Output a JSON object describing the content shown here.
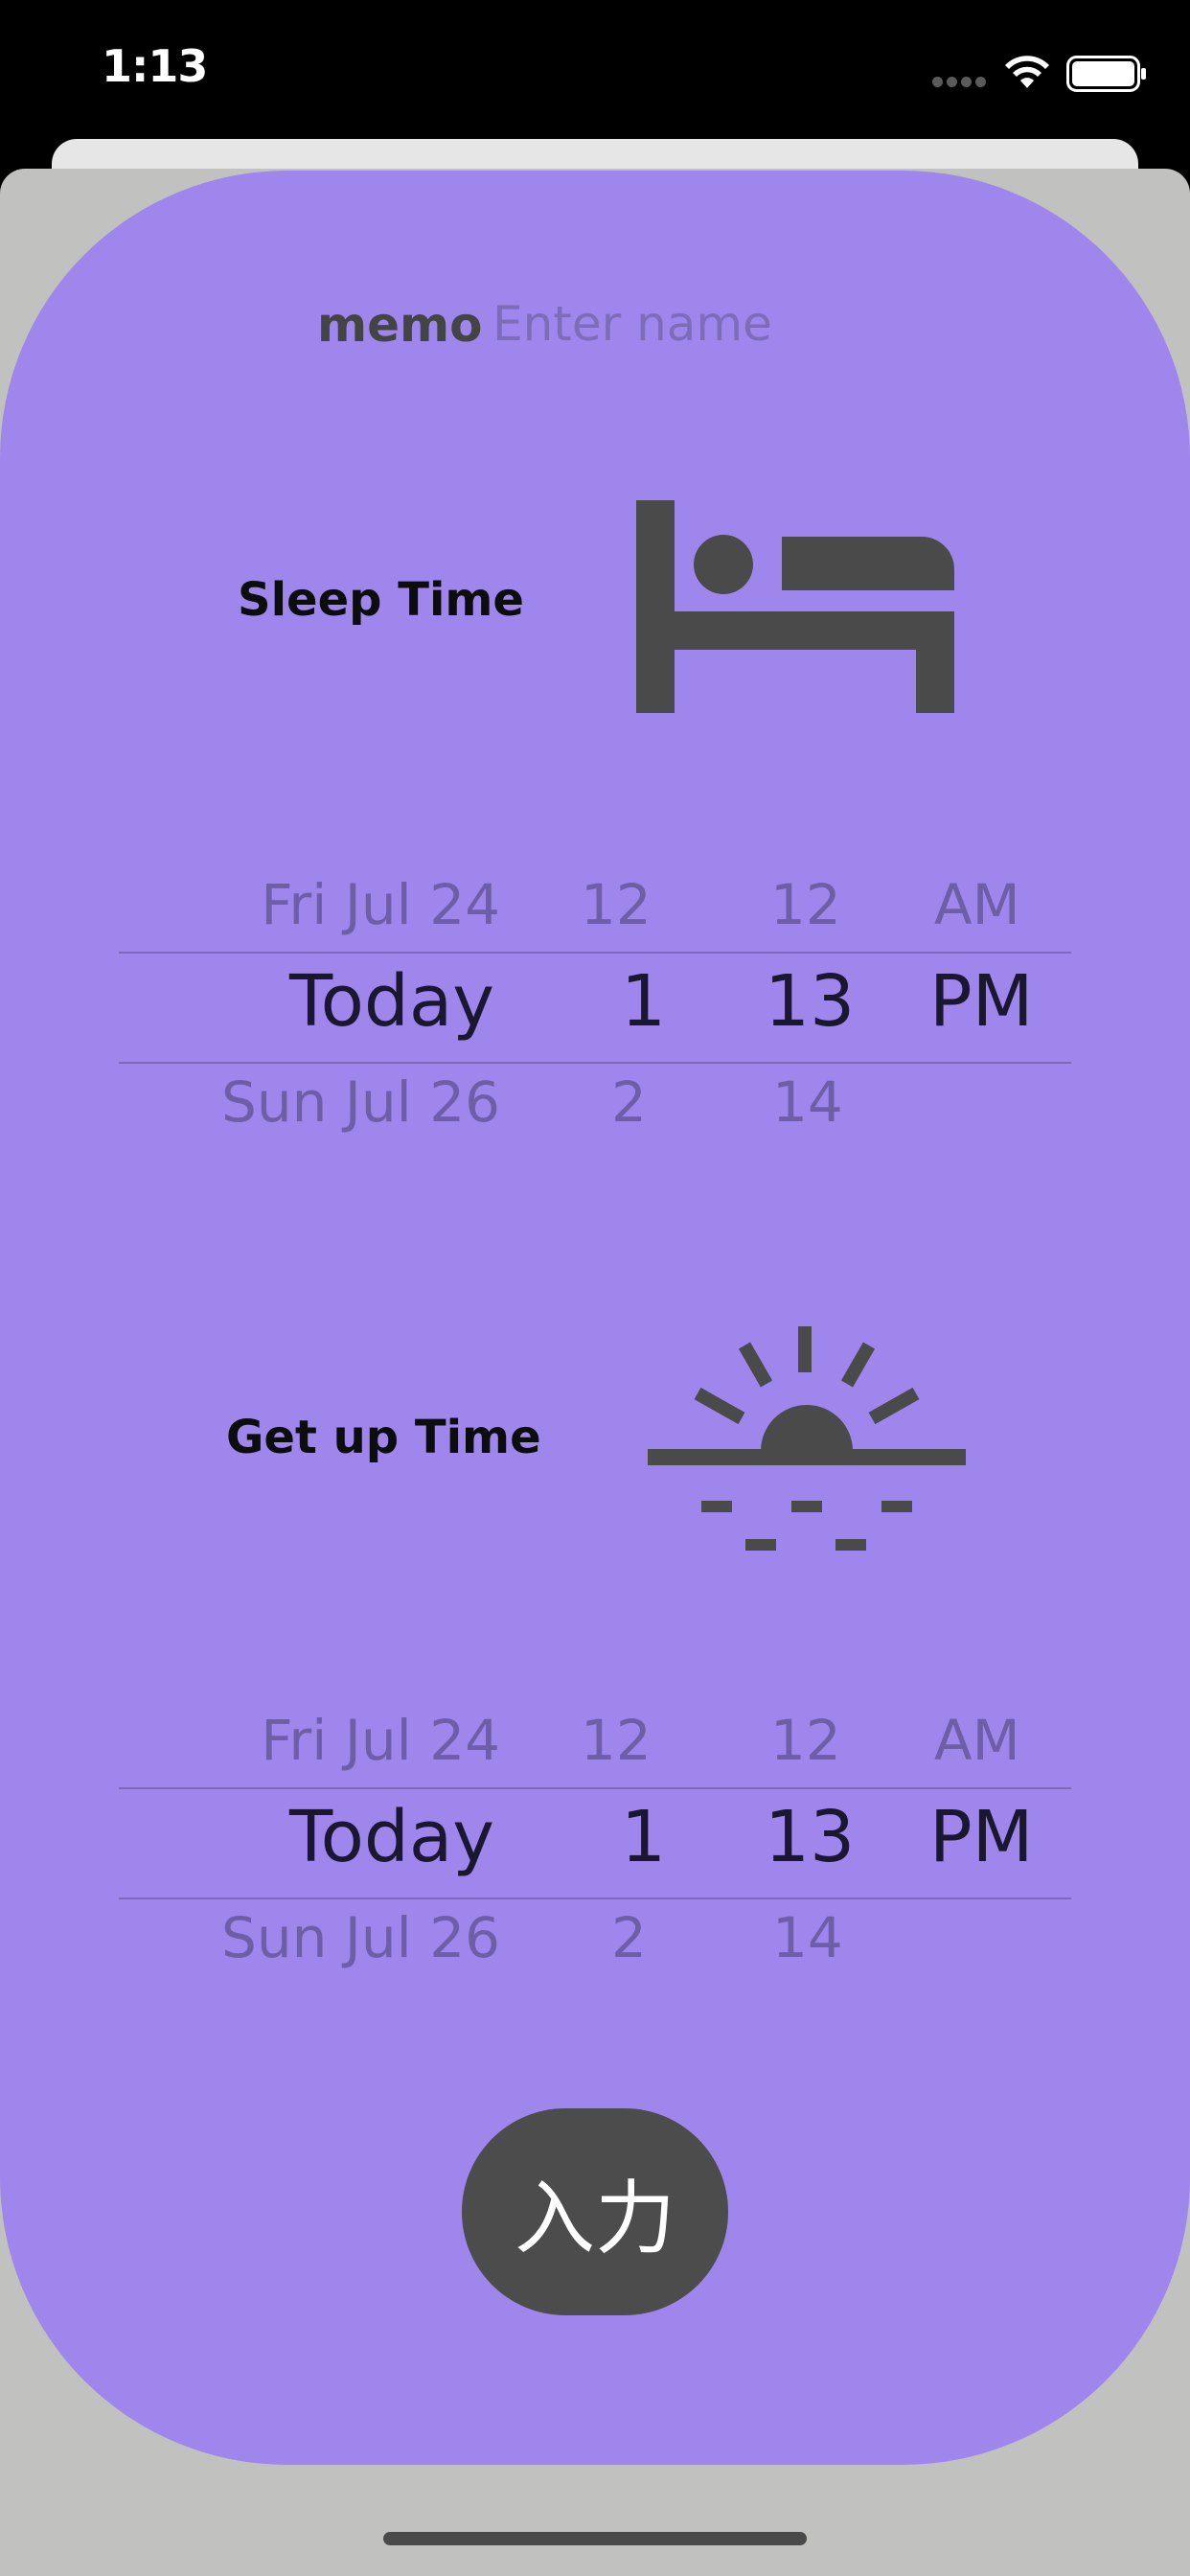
{
  "status_bar": {
    "time": "1:13"
  },
  "memo": {
    "label": "memo",
    "placeholder": "Enter name",
    "value": ""
  },
  "sleep": {
    "label": "Sleep Time",
    "icon": "bed-icon",
    "picker": {
      "above": {
        "date": "Fri Jul 24",
        "hour": "12",
        "minute": "12",
        "period": "AM"
      },
      "selected": {
        "date": "Today",
        "hour": "1",
        "minute": "13",
        "period": "PM"
      },
      "below": {
        "date": "Sun Jul 26",
        "hour": "2",
        "minute": "14",
        "period": ""
      }
    }
  },
  "getup": {
    "label": "Get up Time",
    "icon": "sunrise-icon",
    "picker": {
      "above": {
        "date": "Fri Jul 24",
        "hour": "12",
        "minute": "12",
        "period": "AM"
      },
      "selected": {
        "date": "Today",
        "hour": "1",
        "minute": "13",
        "period": "PM"
      },
      "below": {
        "date": "Sun Jul 26",
        "hour": "2",
        "minute": "14",
        "period": ""
      }
    }
  },
  "submit": {
    "label": "入力"
  },
  "colors": {
    "card": "#9f86ed",
    "sheet": "#c1c2c0",
    "button": "#4c4c4c",
    "icon": "#4a4a4a"
  }
}
